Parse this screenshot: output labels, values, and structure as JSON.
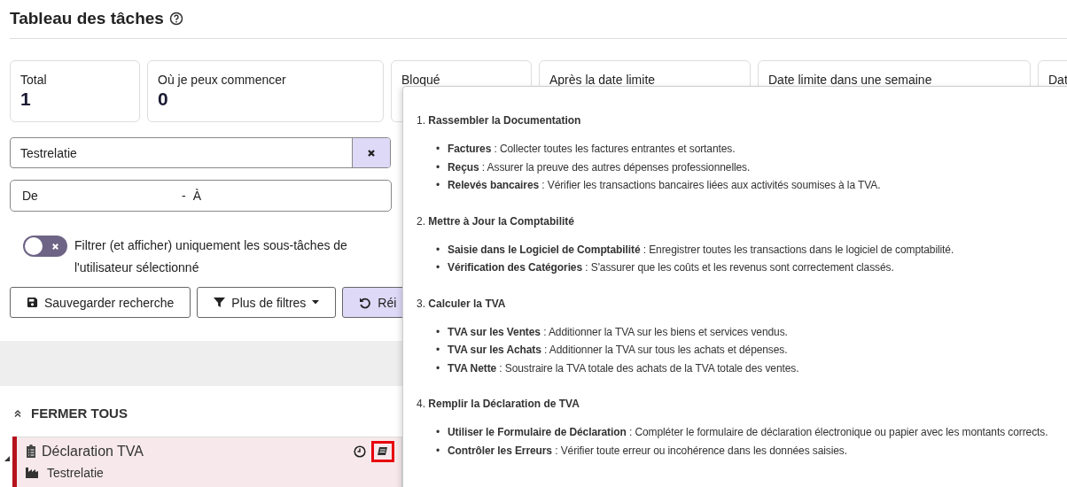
{
  "title": "Tableau des tâches",
  "cards": [
    {
      "label": "Total",
      "value": "1"
    },
    {
      "label": "Où je peux commencer",
      "value": "0"
    },
    {
      "label": "Bloqué"
    },
    {
      "label": "Après la date limite"
    },
    {
      "label": "Date limite dans une semaine"
    },
    {
      "label": "Dat"
    }
  ],
  "search": {
    "value": "Testrelatie"
  },
  "date_range": {
    "from": "De",
    "separator": "-",
    "to": "À"
  },
  "toggle": {
    "on": false,
    "label": "Filtrer (et afficher) uniquement les sous-tâches de l'utilisateur sélectionné"
  },
  "buttons": [
    {
      "kind": "save",
      "label": "Sauvegarder recherche"
    },
    {
      "kind": "filter",
      "label": "Plus de filtres"
    },
    {
      "kind": "reset",
      "label": "Réi"
    }
  ],
  "collapse_all": "FERMER TOUS",
  "task": {
    "title": "Déclaration TVA",
    "client": "Testrelatie",
    "expanded": true,
    "color": "#b5121b"
  },
  "popover": {
    "bullet": "•",
    "sections": [
      {
        "heading": "1. **Rassembler la Documentation**",
        "items": [
          "**Factures** : Collecter toutes les factures entrantes et sortantes.",
          "**Reçus** : Assurer la preuve des autres dépenses professionnelles.",
          "**Relevés bancaires** : Vérifier les transactions bancaires liées aux activités soumises à la TVA."
        ]
      },
      {
        "heading": "2. **Mettre à Jour la Comptabilité**",
        "items": [
          "**Saisie dans le Logiciel de Comptabilité** : Enregistrer toutes les transactions dans le logiciel de comptabilité.",
          "**Vérification des Catégories** : S'assurer que les coûts et les revenus sont correctement classés."
        ]
      },
      {
        "heading": "3. **Calculer la TVA**",
        "items": [
          "**TVA sur les Ventes** : Additionner la TVA sur les biens et services vendus.",
          "**TVA sur les Achats** : Additionner la TVA sur tous les achats et dépenses.",
          "**TVA Nette** : Soustraire la TVA totale des achats de la TVA totale des ventes."
        ]
      },
      {
        "heading": "4. **Remplir la Déclaration de TVA**",
        "items": [
          "**Utiliser le Formulaire de Déclaration** : Compléter le formulaire de déclaration électronique ou papier avec les montants corrects.",
          "**Contrôler les Erreurs** : Vérifier toute erreur ou incohérence dans les données saisies."
        ]
      }
    ]
  }
}
